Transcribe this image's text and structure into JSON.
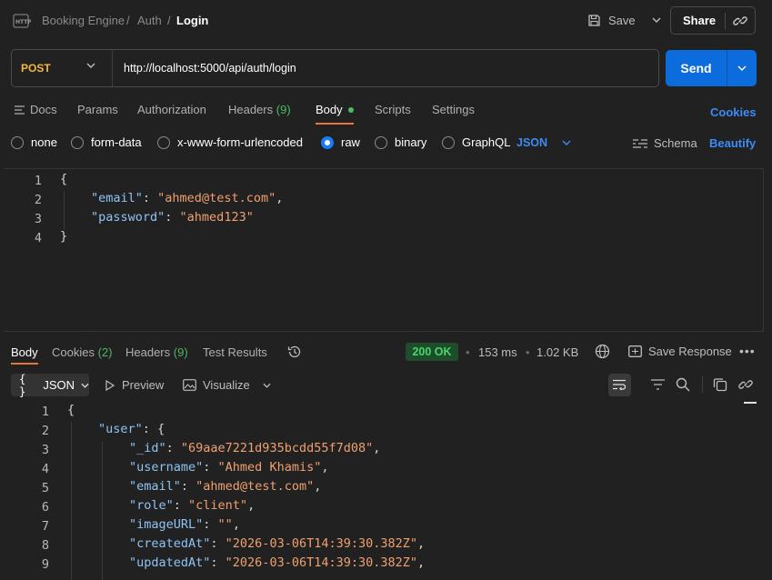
{
  "breadcrumb": {
    "icon": "http-icon",
    "items": [
      "Booking Engine",
      "Auth"
    ],
    "current": "Login",
    "separator": "/"
  },
  "header": {
    "save_label": "Save",
    "share_label": "Share"
  },
  "request": {
    "method": "POST",
    "url": "http://localhost:5000/api/auth/login",
    "send_label": "Send"
  },
  "request_tabs": {
    "docs": "Docs",
    "params": "Params",
    "authorization": "Authorization",
    "headers": "Headers",
    "headers_count": "(9)",
    "body": "Body",
    "scripts": "Scripts",
    "settings": "Settings",
    "cookies": "Cookies"
  },
  "body_types": {
    "none": "none",
    "form_data": "form-data",
    "urlencoded": "x-www-form-urlencoded",
    "raw": "raw",
    "binary": "binary",
    "graphql": "GraphQL",
    "selected_format": "JSON",
    "schema": "Schema",
    "beautify": "Beautify"
  },
  "request_body": {
    "lines": [
      "1",
      "2",
      "3",
      "4"
    ],
    "open": "{",
    "close": "}",
    "email_key": "\"email\"",
    "email_val": "\"ahmed@test.com\"",
    "password_key": "\"password\"",
    "password_val": "\"ahmed123\""
  },
  "response_tabs": {
    "body": "Body",
    "cookies": "Cookies",
    "cookies_count": "(2)",
    "headers": "Headers",
    "headers_count": "(9)",
    "test_results": "Test Results"
  },
  "response_meta": {
    "status": "200 OK",
    "time": "153 ms",
    "size": "1.02 KB",
    "save_response": "Save Response"
  },
  "response_toolbar": {
    "format": "JSON",
    "preview": "Preview",
    "visualize": "Visualize"
  },
  "response_body": {
    "lines": [
      "1",
      "2",
      "3",
      "4",
      "5",
      "6",
      "7",
      "8",
      "9"
    ],
    "open": "{",
    "user_key": "\"user\"",
    "id_key": "\"_id\"",
    "id_val": "\"69aae7221d935bcdd55f7d08\"",
    "username_key": "\"username\"",
    "username_val": "\"Ahmed Khamis\"",
    "email_key": "\"email\"",
    "email_val": "\"ahmed@test.com\"",
    "role_key": "\"role\"",
    "role_val": "\"client\"",
    "image_key": "\"imageURL\"",
    "image_val": "\"\"",
    "created_key": "\"createdAt\"",
    "created_val": "\"2026-03-06T14:39:30.382Z\"",
    "updated_key": "\"updatedAt\"",
    "updated_val": "\"2026-03-06T14:39:30.382Z\""
  },
  "colors": {
    "accent": "#e9723d",
    "primary": "#0c6cdc",
    "link": "#3b8cf5",
    "success": "#4cd36b",
    "method": "#f5b73b"
  }
}
